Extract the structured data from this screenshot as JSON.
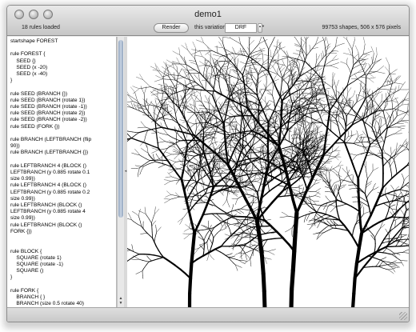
{
  "window": {
    "title": "demo1"
  },
  "toolbar": {
    "rules_loaded": "18 rules loaded",
    "render_label": "Render",
    "variation_label": "this variation:",
    "variation_value": "DRF",
    "shape_info": "99753 shapes, 506 x 576 pixels"
  },
  "editor": {
    "text": "startshape FOREST\n\nrule FOREST {\n    SEED {}\n    SEED (x -20)\n    SEED (x -40)\n}\n\nrule SEED (BRANCH {})\nrule SEED (BRANCH (rotate 1})\nrule SEED (BRANCH (rotate -1})\nrule SEED (BRANCH (rotate 2})\nrule SEED (BRANCH (rotate -2})\nrule SEED (FORK {})\n\nrule BRANCH (LEFTBRANCH (flip\n90})\nrule BRANCH (LEFTBRANCH {})\n\nrule LEFTBRANCH 4 (BLOCK ()\nLEFTBRANCH (y 0.885 rotate 0.1\nsize 0.99})\nrule LEFTBRANCH 4 (BLOCK ()\nLEFTBRANCH (y 0.885 rotate 0.2\nsize 0.99})\nrule LEFTBRANCH (BLOCK ()\nLEFTBRANCH (y 0.885 rotate 4\nsize 0.99})\nrule LEFTBRANCH (BLOCK ()\nFORK {})\n\n\nrule BLOCK {\n    SQUARE (rotate 1)\n    SQUARE (rotate -1)\n    SQUARE ()\n}\n\nrule FORK {\n    BRANCH { }\n    BRANCH (size 0.5 rotate 40)"
  },
  "scroll": {
    "up_arrow": "▲",
    "down_arrow": "▼"
  },
  "splitter": {
    "grip": "◂"
  },
  "stepper": {
    "glyph": "▲▼"
  },
  "colors": {
    "ink": "#000000",
    "canvas": "#ffffff",
    "scroll_thumb": "#9fb1c8"
  }
}
